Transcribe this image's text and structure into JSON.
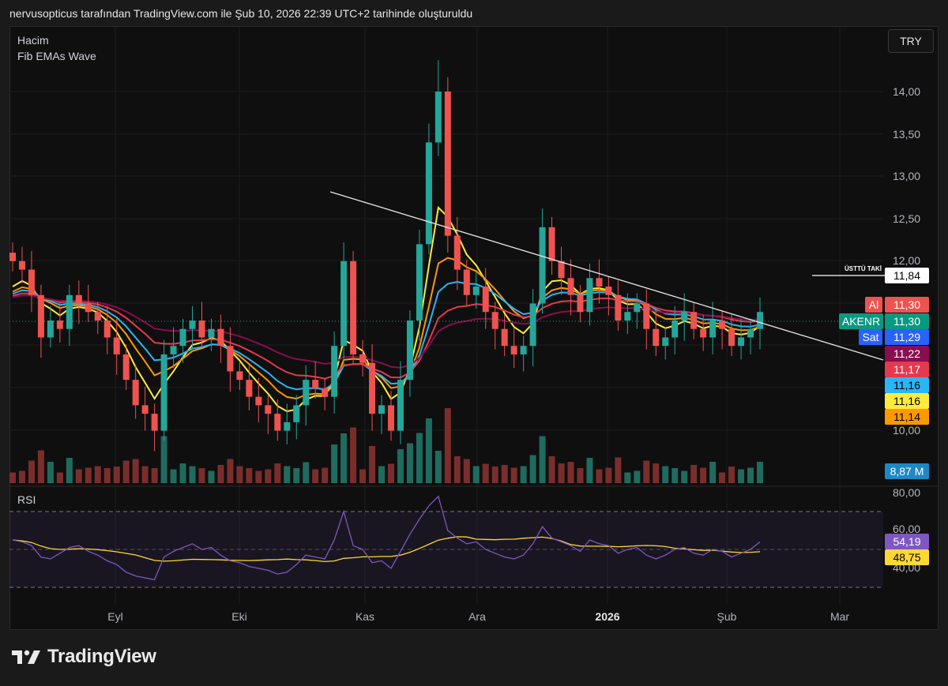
{
  "caption": "nervusopticus tarafından TradingView.com ile Şub 10, 2026 22:39 UTC+2 tarihinde oluşturuldu",
  "legend": {
    "volume": "Hacim",
    "ema": "Fib EMAs Wave",
    "rsi": "RSI"
  },
  "currency_button": "TRY",
  "brand": "TradingView",
  "icons": {
    "logo": "tradingview-logo-icon"
  },
  "colors": {
    "up": "#26a69a",
    "down": "#ef5350",
    "up_volume": "#1f6b5f",
    "down_volume": "#7a2e2c",
    "ema_yellow": "#ffeb3b",
    "ema_orange": "#ff9800",
    "ema_cyan": "#29b6f6",
    "ema_red": "#e53950",
    "ema_maroon": "#880e4f",
    "rsi_line": "#7e57c2",
    "rsi_ma": "#fdd835"
  },
  "chart_data": {
    "type": "candlestick",
    "symbol": "AKENR",
    "currency": "TRY",
    "price_axis": {
      "ticks": [
        "14,00",
        "13,50",
        "13,00",
        "12,50",
        "12,00",
        "10,00"
      ],
      "range": [
        9.6,
        14.5
      ]
    },
    "x_axis": {
      "labels": [
        "Eyl",
        "Eki",
        "Kas",
        "Ara",
        "2026",
        "Şub",
        "Mar"
      ]
    },
    "price_labels": [
      {
        "name": "Al",
        "value": "11,30",
        "color": "#ef5350"
      },
      {
        "name": "AKENR",
        "value": "11,30",
        "color": "#089981"
      },
      {
        "name": "Sat",
        "value": "11,29",
        "color": "#2962ff"
      },
      {
        "name": "",
        "value": "11,22",
        "color": "#880e4f"
      },
      {
        "name": "",
        "value": "11,17",
        "color": "#e53950"
      },
      {
        "name": "",
        "value": "11,16",
        "color": "#29b6f6"
      },
      {
        "name": "",
        "value": "11,16",
        "color": "#ffeb3b"
      },
      {
        "name": "",
        "value": "11,14",
        "color": "#ff9800"
      }
    ],
    "horizontal_line": {
      "label": "ÜSTTÜ TAKİ",
      "value": "11,84",
      "price": 11.84
    },
    "volume_label": "8,87 M",
    "rsi": {
      "ticks": [
        "80,00",
        "60,00",
        "40,00"
      ],
      "range": [
        30,
        82
      ],
      "bands": [
        70,
        30
      ],
      "mid": 50,
      "value_label": "54,19",
      "ma_label": "48,75"
    },
    "closes": [
      12.0,
      11.9,
      11.6,
      11.1,
      11.3,
      11.2,
      11.6,
      11.5,
      11.4,
      11.3,
      11.1,
      10.9,
      10.6,
      10.3,
      10.2,
      10.0,
      10.9,
      11.0,
      11.2,
      11.3,
      11.1,
      11.2,
      11.0,
      10.7,
      10.6,
      10.4,
      10.3,
      10.2,
      10.0,
      10.1,
      10.3,
      10.6,
      10.5,
      10.4,
      11.0,
      12.0,
      10.9,
      10.8,
      10.2,
      10.3,
      10.0,
      10.6,
      11.3,
      12.2,
      13.4,
      14.0,
      12.3,
      11.9,
      11.6,
      11.7,
      11.4,
      11.2,
      11.0,
      10.9,
      11.0,
      11.5,
      12.4,
      12.0,
      11.8,
      11.6,
      11.4,
      11.8,
      11.7,
      11.6,
      11.3,
      11.4,
      11.5,
      11.2,
      11.0,
      11.1,
      11.3,
      11.4,
      11.2,
      11.1,
      11.3,
      11.2,
      11.0,
      11.1,
      11.2,
      11.4
    ],
    "rsi_values": [
      55,
      54,
      52,
      46,
      45,
      48,
      51,
      52,
      49,
      47,
      44,
      42,
      38,
      36,
      35,
      34,
      46,
      49,
      51,
      53,
      50,
      51,
      47,
      44,
      43,
      41,
      40,
      39,
      37,
      38,
      42,
      47,
      46,
      45,
      55,
      70,
      52,
      50,
      43,
      44,
      40,
      49,
      58,
      66,
      73,
      78,
      60,
      56,
      53,
      54,
      50,
      48,
      46,
      45,
      47,
      53,
      62,
      56,
      54,
      52,
      49,
      55,
      53,
      52,
      48,
      50,
      51,
      47,
      45,
      47,
      50,
      51,
      48,
      47,
      50,
      49,
      46,
      48,
      50,
      54
    ]
  }
}
